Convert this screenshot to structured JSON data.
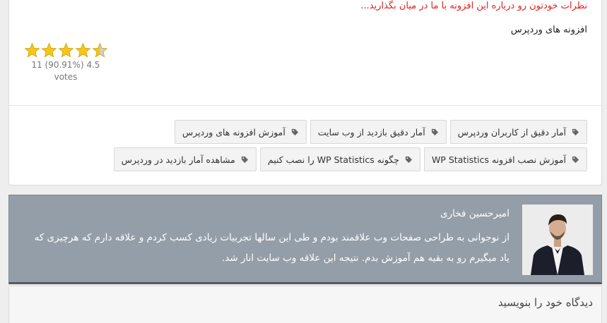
{
  "post": {
    "invite_text": "نظرات خودتون رو درباره این افزونه با ما در میان بگذارید...",
    "category": "افزونه های وردپرس"
  },
  "rating": {
    "value": 4.5,
    "max": 5,
    "summary": "11 (90.91%) 4.5",
    "votes_label": "votes",
    "star_color": "#f5c518",
    "star_empty_color": "#cfcfcf"
  },
  "tags": [
    {
      "label": "آمار دقیق از کاربران وردپرس",
      "icon": "tag-icon"
    },
    {
      "label": "آمار دقیق بازدید از وب سایت",
      "icon": "tag-icon"
    },
    {
      "label": "آموزش افزونه های وردپرس",
      "icon": "tag-icon"
    },
    {
      "label": "آموزش نصب افزونه WP Statistics",
      "icon": "tag-icon"
    },
    {
      "label": "چگونه WP Statistics را نصب کنیم",
      "icon": "tag-icon"
    },
    {
      "label": "مشاهده آمار بازدید در وردپرس",
      "icon": "tag-icon"
    }
  ],
  "author": {
    "name": "امیرحسین فخاری",
    "bio": "از نوجوانی به طراحی صفحات وب علاقمند بودم و طی این سالها تجربیات زیادی کسب کردم و علاقه دارم که هرچیزی که یاد میگیرم رو به بقیه هم آموزش بدم. نتیجه این علاقه وب سایت انار شد.",
    "box_color": "#949ea8"
  },
  "comment_form": {
    "title": "دیدگاه خود را بنویسید"
  }
}
